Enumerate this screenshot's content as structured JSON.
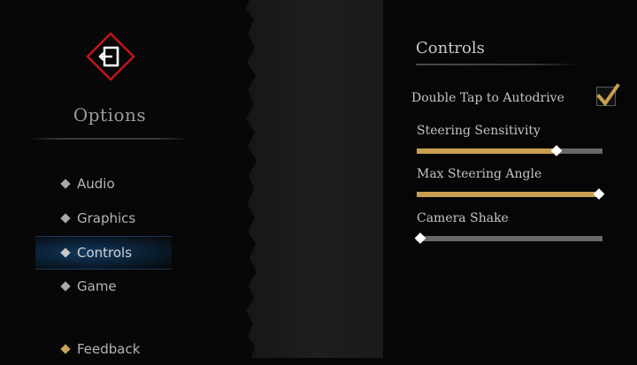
{
  "sidebar": {
    "title": "Options",
    "items": [
      {
        "label": "Audio"
      },
      {
        "label": "Graphics"
      },
      {
        "label": "Controls"
      },
      {
        "label": "Game"
      }
    ],
    "feedback_label": "Feedback"
  },
  "icons": {
    "logo": "exit-door-icon",
    "menu_bullet": "diamond-bullet-icon",
    "check": "checkmark-icon"
  },
  "colors": {
    "accent_gold": "#c89e50",
    "logo_red": "#c0151b",
    "selected_blue": "#123a5e",
    "track_gray": "#686868"
  },
  "controls": {
    "title": "Controls",
    "double_tap_label": "Double Tap to Autodrive",
    "double_tap_checked": true,
    "sliders": [
      {
        "label": "Steering Sensitivity",
        "value": 0.75
      },
      {
        "label": "Max Steering Angle",
        "value": 0.98
      },
      {
        "label": "Camera Shake",
        "value": 0.02
      }
    ]
  }
}
